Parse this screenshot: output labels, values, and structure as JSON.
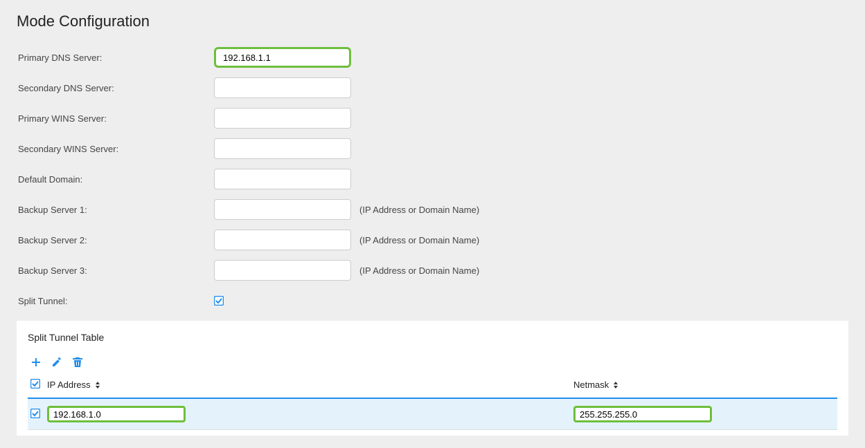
{
  "title": "Mode Configuration",
  "fields": {
    "primary_dns": {
      "label": "Primary DNS Server:",
      "value": "192.168.1.1"
    },
    "secondary_dns": {
      "label": "Secondary DNS Server:",
      "value": ""
    },
    "primary_wins": {
      "label": "Primary WINS Server:",
      "value": ""
    },
    "secondary_wins": {
      "label": "Secondary WINS Server:",
      "value": ""
    },
    "default_domain": {
      "label": "Default Domain:",
      "value": ""
    },
    "backup1": {
      "label": "Backup Server 1:",
      "value": "",
      "hint": "(IP Address or Domain Name)"
    },
    "backup2": {
      "label": "Backup Server 2:",
      "value": "",
      "hint": "(IP Address or Domain Name)"
    },
    "backup3": {
      "label": "Backup Server 3:",
      "value": "",
      "hint": "(IP Address or Domain Name)"
    },
    "split_tunnel": {
      "label": "Split Tunnel:",
      "checked": true
    }
  },
  "split_tunnel_table": {
    "title": "Split Tunnel Table",
    "columns": {
      "ip": "IP Address",
      "netmask": "Netmask"
    },
    "rows": [
      {
        "ip": "192.168.1.0",
        "netmask": "255.255.255.0",
        "selected": true
      }
    ]
  }
}
